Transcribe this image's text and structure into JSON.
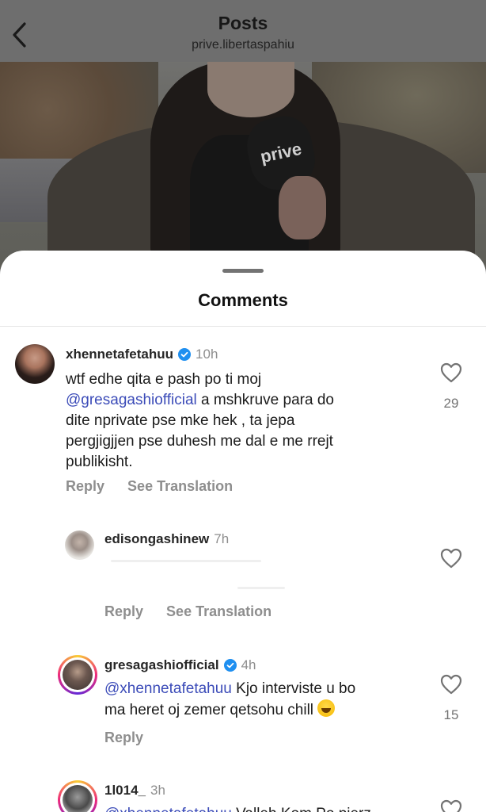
{
  "topbar": {
    "title": "Posts",
    "subtitle": "prive.libertaspahiu"
  },
  "post_image": {
    "mic_brand": "prive"
  },
  "sheet": {
    "title": "Comments"
  },
  "comments": [
    {
      "username": "xhennetafetahuu",
      "verified": true,
      "time": "10h",
      "text_line1": "wtf edhe qita  e pash po ti moj",
      "mention": "@gresagashiofficial",
      "text_line2_rest": " a mshkruve para do",
      "text_line3": "dite nprivate pse mke hek , ta jepa",
      "text_line4": "pergjigjjen pse duhesh me dal e me rrejt",
      "text_line5": "publikisht.",
      "reply_label": "Reply",
      "translation_label": "See Translation",
      "likes": "29"
    },
    {
      "username": "edisongashinew",
      "verified": false,
      "time": "7h",
      "reply_label": "Reply",
      "translation_label": "See Translation"
    },
    {
      "username": "gresagashiofficial",
      "verified": true,
      "time": "4h",
      "mention": "@xhennetafetahuu",
      "text_line1_rest": " Kjo interviste u bo",
      "text_line2": "ma heret oj zemer qetsohu chill",
      "emoji": "face-with-tears-of-joy",
      "reply_label": "Reply",
      "likes": "15"
    },
    {
      "username": "1l014_",
      "verified": false,
      "time": "3h",
      "mention": "@xhennetafetahuu",
      "text_line1_rest": " Valleh Kom Po pierz"
    }
  ],
  "colors": {
    "mention": "#3b4bb8",
    "verified": "#1f8ff0",
    "muted": "#8e8e8e"
  }
}
